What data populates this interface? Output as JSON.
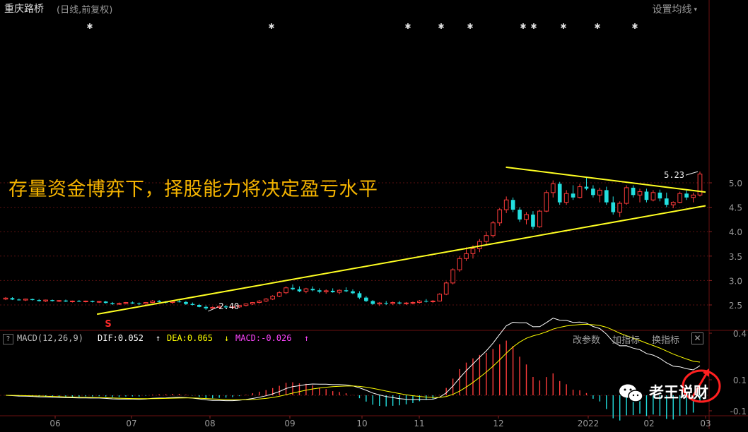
{
  "header": {
    "stock_name": "重庆路桥",
    "mode": "(日线,前复权)",
    "ma_setting": "设置均线"
  },
  "annotation": "存量资金博弈下，择股能力将决定盈亏水平",
  "watermark": "老王说财",
  "macd_panel": {
    "help": "?",
    "label": "MACD(12,26,9)",
    "dif": "DIF:0.052",
    "dea": "DEA:0.065",
    "macd": "MACD:-0.026",
    "dif_arrow": "↑",
    "dea_arrow": "↓",
    "macd_arrow": "↑",
    "buttons": [
      "改参数",
      "加指标",
      "换指标"
    ],
    "close": "✕"
  },
  "colors": {
    "up": "#ff3b3b",
    "down": "#22dede",
    "trendline": "#ffff22",
    "dif": "#ffffff",
    "dea": "#ffff00",
    "macd_label": "#ff44ff",
    "grid": "#5a1010"
  },
  "chart_data": {
    "type": "candlestick",
    "price_axis": {
      "ticks": [
        "5.0",
        "4.5",
        "4.0",
        "3.5",
        "3.0",
        "2.5"
      ],
      "values": [
        5.0,
        4.5,
        4.0,
        3.5,
        3.0,
        2.5
      ]
    },
    "macd_axis": {
      "ticks": [
        "0.4",
        "0.1",
        "-0.1"
      ],
      "values": [
        0.4,
        0.1,
        -0.1
      ]
    },
    "x_ticks": [
      "06",
      "07",
      "08",
      "09",
      "10",
      "11",
      "12",
      "2022",
      "02",
      "03"
    ],
    "price_labels": {
      "high": "5.23",
      "low": "2.40",
      "signal": "S"
    },
    "trendlines": [
      {
        "name": "support",
        "from": {
          "x": "2021-06-18",
          "y": 2.31
        },
        "to": {
          "x": "2022-03-01",
          "y": 4.53
        }
      },
      {
        "name": "resistance",
        "from": {
          "x": "2021-12-07",
          "y": 5.32
        },
        "to": {
          "x": "2022-03-01",
          "y": 4.81
        }
      }
    ],
    "candles": [
      [
        2.62,
        2.66,
        2.6,
        2.64
      ],
      [
        2.64,
        2.66,
        2.6,
        2.61
      ],
      [
        2.61,
        2.63,
        2.59,
        2.6
      ],
      [
        2.6,
        2.63,
        2.58,
        2.62
      ],
      [
        2.62,
        2.63,
        2.59,
        2.6
      ],
      [
        2.6,
        2.62,
        2.57,
        2.58
      ],
      [
        2.58,
        2.61,
        2.56,
        2.6
      ],
      [
        2.6,
        2.61,
        2.57,
        2.58
      ],
      [
        2.58,
        2.6,
        2.56,
        2.59
      ],
      [
        2.59,
        2.61,
        2.56,
        2.57
      ],
      [
        2.57,
        2.59,
        2.55,
        2.58
      ],
      [
        2.58,
        2.6,
        2.56,
        2.57
      ],
      [
        2.57,
        2.59,
        2.55,
        2.58
      ],
      [
        2.58,
        2.59,
        2.55,
        2.56
      ],
      [
        2.56,
        2.58,
        2.54,
        2.57
      ],
      [
        2.57,
        2.58,
        2.53,
        2.54
      ],
      [
        2.54,
        2.56,
        2.5,
        2.52
      ],
      [
        2.52,
        2.55,
        2.5,
        2.53
      ],
      [
        2.53,
        2.56,
        2.51,
        2.55
      ],
      [
        2.55,
        2.57,
        2.52,
        2.53
      ],
      [
        2.53,
        2.55,
        2.5,
        2.52
      ],
      [
        2.52,
        2.56,
        2.5,
        2.55
      ],
      [
        2.55,
        2.6,
        2.54,
        2.58
      ],
      [
        2.58,
        2.6,
        2.55,
        2.56
      ],
      [
        2.56,
        2.58,
        2.53,
        2.55
      ],
      [
        2.55,
        2.58,
        2.52,
        2.57
      ],
      [
        2.57,
        2.6,
        2.55,
        2.56
      ],
      [
        2.56,
        2.58,
        2.5,
        2.52
      ],
      [
        2.52,
        2.55,
        2.49,
        2.5
      ],
      [
        2.5,
        2.52,
        2.45,
        2.46
      ],
      [
        2.46,
        2.49,
        2.4,
        2.43
      ],
      [
        2.43,
        2.47,
        2.41,
        2.45
      ],
      [
        2.45,
        2.49,
        2.43,
        2.47
      ],
      [
        2.47,
        2.5,
        2.44,
        2.45
      ],
      [
        2.45,
        2.48,
        2.42,
        2.46
      ],
      [
        2.46,
        2.5,
        2.44,
        2.49
      ],
      [
        2.49,
        2.53,
        2.47,
        2.52
      ],
      [
        2.52,
        2.56,
        2.5,
        2.55
      ],
      [
        2.55,
        2.6,
        2.53,
        2.58
      ],
      [
        2.58,
        2.64,
        2.56,
        2.62
      ],
      [
        2.62,
        2.7,
        2.6,
        2.68
      ],
      [
        2.68,
        2.78,
        2.66,
        2.75
      ],
      [
        2.75,
        2.88,
        2.72,
        2.85
      ],
      [
        2.85,
        2.92,
        2.8,
        2.82
      ],
      [
        2.82,
        2.88,
        2.76,
        2.78
      ],
      [
        2.78,
        2.85,
        2.74,
        2.83
      ],
      [
        2.83,
        2.88,
        2.78,
        2.8
      ],
      [
        2.8,
        2.84,
        2.74,
        2.77
      ],
      [
        2.77,
        2.82,
        2.73,
        2.79
      ],
      [
        2.79,
        2.84,
        2.75,
        2.76
      ],
      [
        2.76,
        2.82,
        2.72,
        2.8
      ],
      [
        2.8,
        2.86,
        2.76,
        2.78
      ],
      [
        2.78,
        2.82,
        2.72,
        2.74
      ],
      [
        2.74,
        2.78,
        2.62,
        2.65
      ],
      [
        2.65,
        2.68,
        2.56,
        2.58
      ],
      [
        2.58,
        2.6,
        2.5,
        2.52
      ],
      [
        2.52,
        2.56,
        2.48,
        2.54
      ],
      [
        2.54,
        2.58,
        2.5,
        2.53
      ],
      [
        2.53,
        2.57,
        2.5,
        2.55
      ],
      [
        2.55,
        2.58,
        2.51,
        2.53
      ],
      [
        2.53,
        2.56,
        2.5,
        2.54
      ],
      [
        2.54,
        2.57,
        2.51,
        2.55
      ],
      [
        2.55,
        2.6,
        2.53,
        2.58
      ],
      [
        2.58,
        2.62,
        2.55,
        2.57
      ],
      [
        2.57,
        2.6,
        2.54,
        2.58
      ],
      [
        2.58,
        2.74,
        2.57,
        2.72
      ],
      [
        2.72,
        2.98,
        2.7,
        2.95
      ],
      [
        2.95,
        3.25,
        2.92,
        3.22
      ],
      [
        3.22,
        3.5,
        3.18,
        3.45
      ],
      [
        3.45,
        3.68,
        3.4,
        3.55
      ],
      [
        3.55,
        3.72,
        3.45,
        3.65
      ],
      [
        3.65,
        3.85,
        3.58,
        3.8
      ],
      [
        3.8,
        4.0,
        3.72,
        3.92
      ],
      [
        3.92,
        4.22,
        3.88,
        4.18
      ],
      [
        4.18,
        4.48,
        4.12,
        4.45
      ],
      [
        4.45,
        4.72,
        4.38,
        4.65
      ],
      [
        4.65,
        4.7,
        4.4,
        4.45
      ],
      [
        4.45,
        4.5,
        4.2,
        4.25
      ],
      [
        4.25,
        4.4,
        4.15,
        4.35
      ],
      [
        4.35,
        4.42,
        4.05,
        4.1
      ],
      [
        4.1,
        4.45,
        4.08,
        4.42
      ],
      [
        4.42,
        4.85,
        4.4,
        4.8
      ],
      [
        4.8,
        5.05,
        4.7,
        4.98
      ],
      [
        4.98,
        5.02,
        4.55,
        4.6
      ],
      [
        4.6,
        4.85,
        4.55,
        4.78
      ],
      [
        4.78,
        4.95,
        4.65,
        4.7
      ],
      [
        4.7,
        4.98,
        4.68,
        4.92
      ],
      [
        4.92,
        5.12,
        4.85,
        4.88
      ],
      [
        4.88,
        4.95,
        4.7,
        4.75
      ],
      [
        4.75,
        4.9,
        4.6,
        4.85
      ],
      [
        4.85,
        4.92,
        4.55,
        4.6
      ],
      [
        4.6,
        4.72,
        4.35,
        4.4
      ],
      [
        4.4,
        4.62,
        4.3,
        4.58
      ],
      [
        4.58,
        4.95,
        4.55,
        4.9
      ],
      [
        4.9,
        4.95,
        4.7,
        4.75
      ],
      [
        4.75,
        4.88,
        4.6,
        4.82
      ],
      [
        4.82,
        4.88,
        4.6,
        4.65
      ],
      [
        4.65,
        4.85,
        4.62,
        4.8
      ],
      [
        4.8,
        4.86,
        4.62,
        4.68
      ],
      [
        4.68,
        4.8,
        4.5,
        4.55
      ],
      [
        4.55,
        4.62,
        4.48,
        4.6
      ],
      [
        4.6,
        4.82,
        4.58,
        4.78
      ],
      [
        4.78,
        4.85,
        4.65,
        4.7
      ],
      [
        4.7,
        4.8,
        4.6,
        4.75
      ],
      [
        4.75,
        5.23,
        4.72,
        5.18
      ]
    ]
  }
}
